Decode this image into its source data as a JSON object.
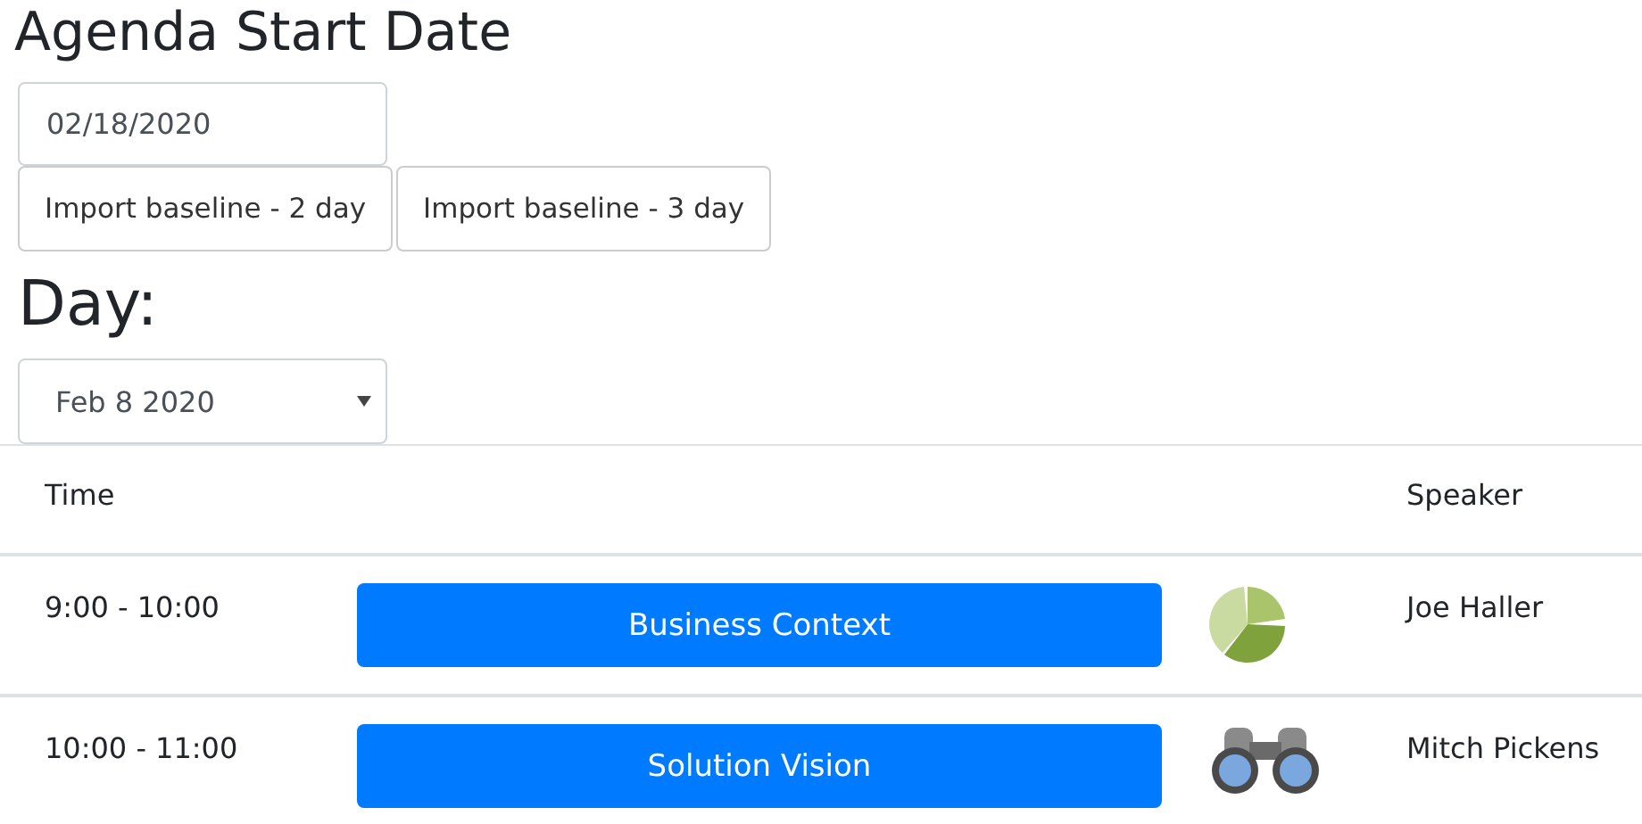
{
  "title": "Agenda Start Date",
  "start_date": {
    "value": "02/18/2020"
  },
  "import_buttons": [
    "Import baseline - 2 day",
    "Import baseline - 3 day"
  ],
  "day_heading": "Day:",
  "day_select": {
    "value": "Feb 8 2020"
  },
  "table": {
    "columns": [
      "Time",
      "",
      "",
      "Speaker"
    ],
    "rows": [
      {
        "time": "9:00 - 10:00",
        "session": "Business Context",
        "icon": {
          "kind": "pie"
        },
        "speaker": "Joe Haller"
      },
      {
        "time": "10:00 - 11:00",
        "session": "Solution Vision",
        "icon": {
          "kind": "binoculars"
        },
        "speaker": "Mitch Pickens"
      }
    ]
  }
}
